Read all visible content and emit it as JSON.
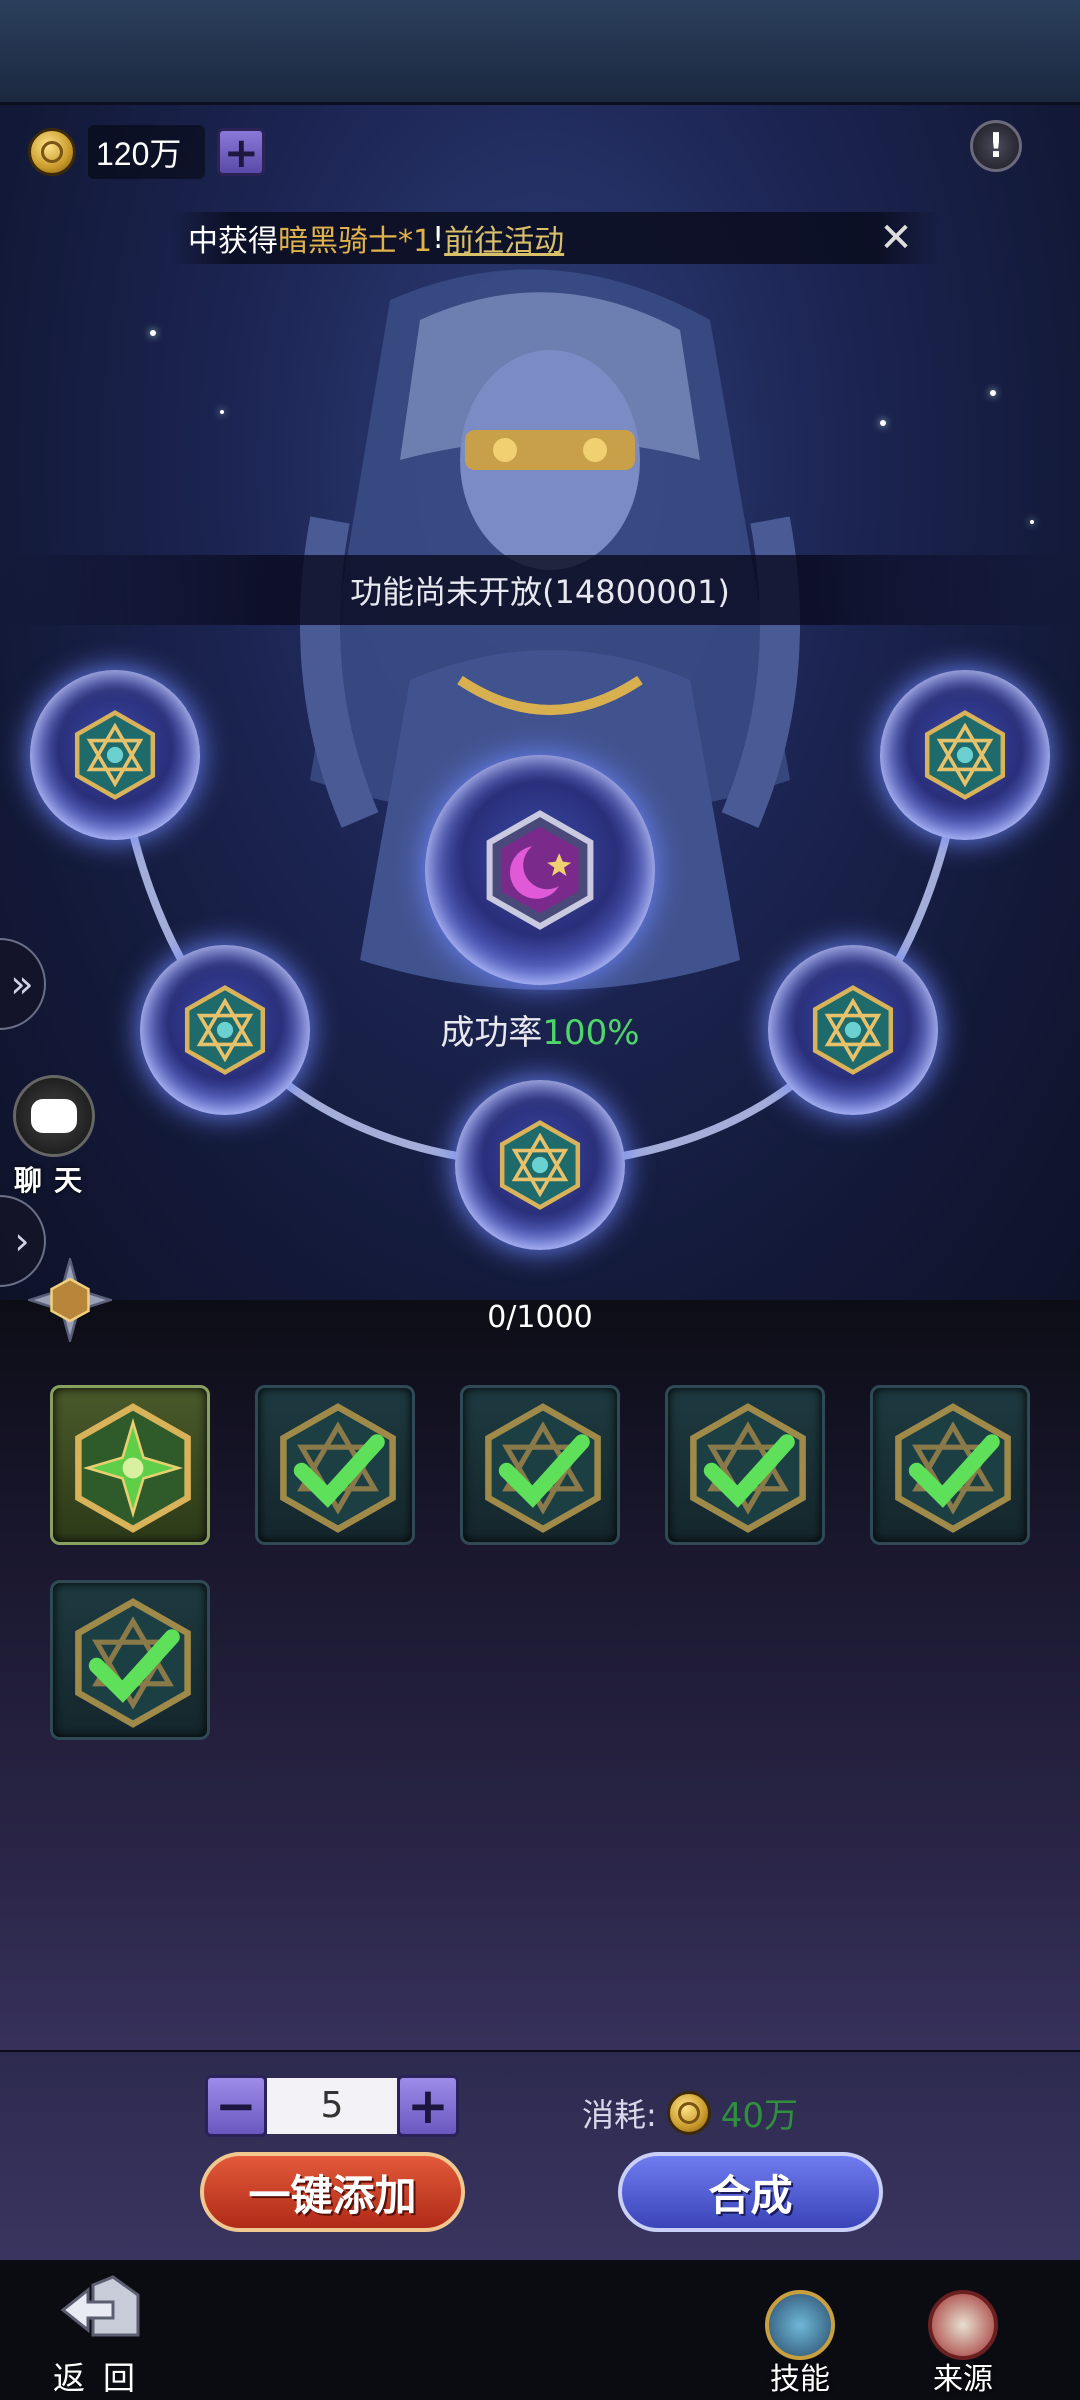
{
  "currency": {
    "amount": "120万",
    "icon": "gold-coin-icon"
  },
  "marquee": {
    "prefix": "中获得",
    "item": "暗黑骑士*1",
    "exclaim": "!",
    "link": "前往活动"
  },
  "notice": "功能尚未开放(14800001)",
  "success_rate": {
    "label": "成功率",
    "value": "100%"
  },
  "progress": "0/1000",
  "chat": {
    "label": "聊天"
  },
  "slots": [
    {
      "state": "selected"
    },
    {
      "state": "checked"
    },
    {
      "state": "checked"
    },
    {
      "state": "checked"
    },
    {
      "state": "checked"
    },
    {
      "state": "checked"
    }
  ],
  "stepper": {
    "minus": "−",
    "value": "5",
    "plus": "+"
  },
  "cost": {
    "label": "消耗:",
    "value": "40万"
  },
  "buttons": {
    "add_all": "一键添加",
    "merge": "合成"
  },
  "footer": {
    "back": "返回",
    "skills": "技能",
    "source": "来源"
  },
  "colors": {
    "accent_green": "#4fd66a",
    "gold": "#e0b24a",
    "add_button": "#c83a22",
    "merge_button": "#4a56cc"
  }
}
